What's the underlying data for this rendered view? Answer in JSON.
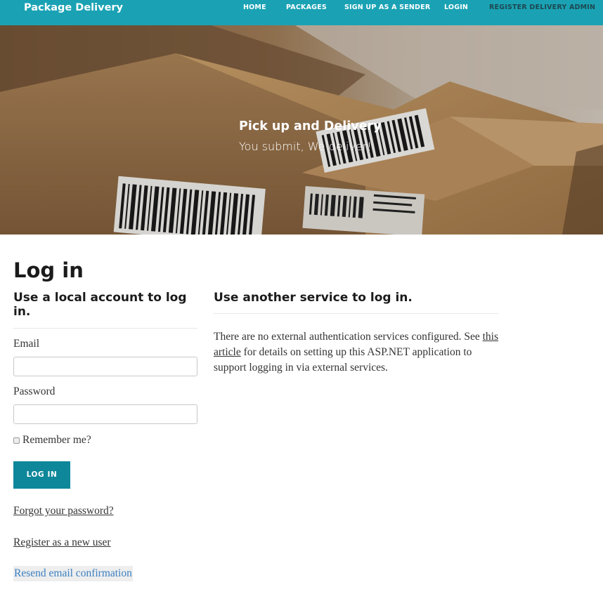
{
  "navbar": {
    "brand": "Package Delivery",
    "links": [
      "HOME",
      "PACKAGES",
      "SIGN UP AS A SENDER",
      "LOGIN",
      "REGISTER DELIVERY ADMIN"
    ]
  },
  "hero": {
    "title": "Pick up and Delivery",
    "subtitle": "You submit, We deliver!"
  },
  "page": {
    "title": "Log in",
    "local_heading_line1": "Use a local account to log",
    "local_heading_line2": "in.",
    "external_heading": "Use another service to log in."
  },
  "form": {
    "email_label": "Email",
    "email_value": "",
    "password_label": "Password",
    "password_value": "",
    "remember_label": "Remember me?",
    "remember_checked": false,
    "submit_label": "LOG IN"
  },
  "links": {
    "forgot": "Forgot your password?",
    "register": "Register as a new user",
    "resend": "Resend email confirmation"
  },
  "external": {
    "text_before": "There are no external authentication services configured. See ",
    "link_text": "this article",
    "text_after": " for details on setting up this ASP.NET application to support logging in via external services."
  },
  "colors": {
    "navbar": "#1aa2b4",
    "button": "#0e879a",
    "resend_link": "#3a7fc1"
  }
}
